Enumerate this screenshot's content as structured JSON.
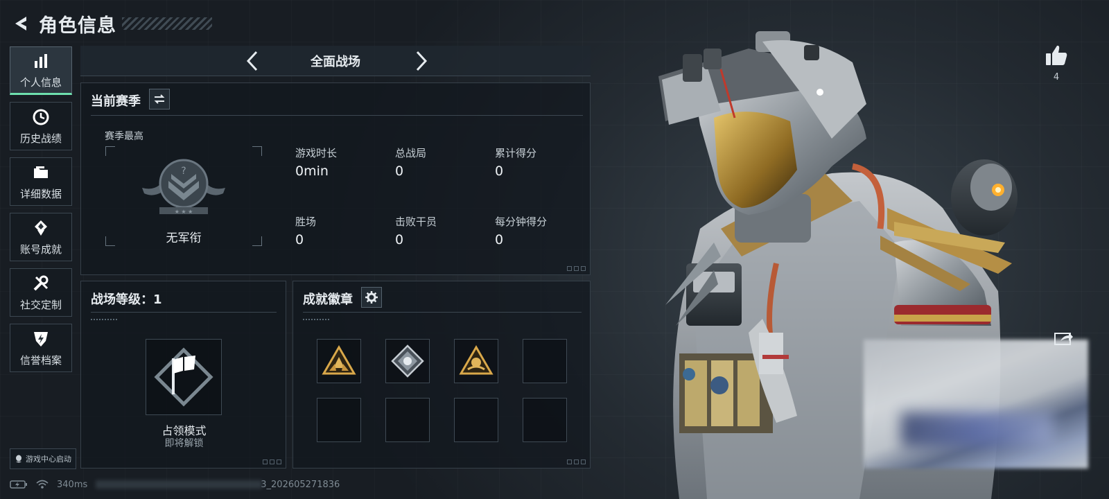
{
  "header": {
    "title": "角色信息"
  },
  "sidebar": {
    "items": [
      {
        "label": "个人信息",
        "icon": "bar-chart-icon",
        "active": true
      },
      {
        "label": "历史战绩",
        "icon": "history-clock-icon",
        "active": false
      },
      {
        "label": "详细数据",
        "icon": "folder-icon",
        "active": false
      },
      {
        "label": "账号成就",
        "icon": "achievement-medal-icon",
        "active": false
      },
      {
        "label": "社交定制",
        "icon": "tools-icon",
        "active": false
      },
      {
        "label": "信誉档案",
        "icon": "reputation-shield-icon",
        "active": false
      }
    ],
    "game_center_label": "游戏中心启动"
  },
  "mode_selector": {
    "title": "全面战场"
  },
  "season_panel": {
    "title": "当前赛季",
    "season_best_label": "赛季最高",
    "rank_label": "无军衔",
    "stats": [
      {
        "label": "游戏时长",
        "value": "0min"
      },
      {
        "label": "总战局",
        "value": "0"
      },
      {
        "label": "累计得分",
        "value": "0"
      },
      {
        "label": "胜场",
        "value": "0"
      },
      {
        "label": "击败干员",
        "value": "0"
      },
      {
        "label": "每分钟得分",
        "value": "0"
      }
    ]
  },
  "battlefield_panel": {
    "title": "战场等级：1",
    "mode_name": "占领模式",
    "mode_status": "即将解锁"
  },
  "achievements_panel": {
    "title": "成就徽章",
    "badges": [
      {
        "icon": "gold-triangle-badge-icon",
        "filled": true
      },
      {
        "icon": "silver-diamond-badge-icon",
        "filled": true
      },
      {
        "icon": "gold-triangle-emblem-badge-icon",
        "filled": true
      },
      {
        "icon": "",
        "filled": false
      },
      {
        "icon": "",
        "filled": false
      },
      {
        "icon": "",
        "filled": false
      },
      {
        "icon": "",
        "filled": false
      },
      {
        "icon": "",
        "filled": false
      }
    ]
  },
  "like": {
    "count": "4"
  },
  "status_bar": {
    "ping": "340ms",
    "id_suffix": "3_202605271836"
  },
  "colors": {
    "accent": "#6ee0ae",
    "gold": "#c9a24a",
    "panel_border": "#364049"
  }
}
